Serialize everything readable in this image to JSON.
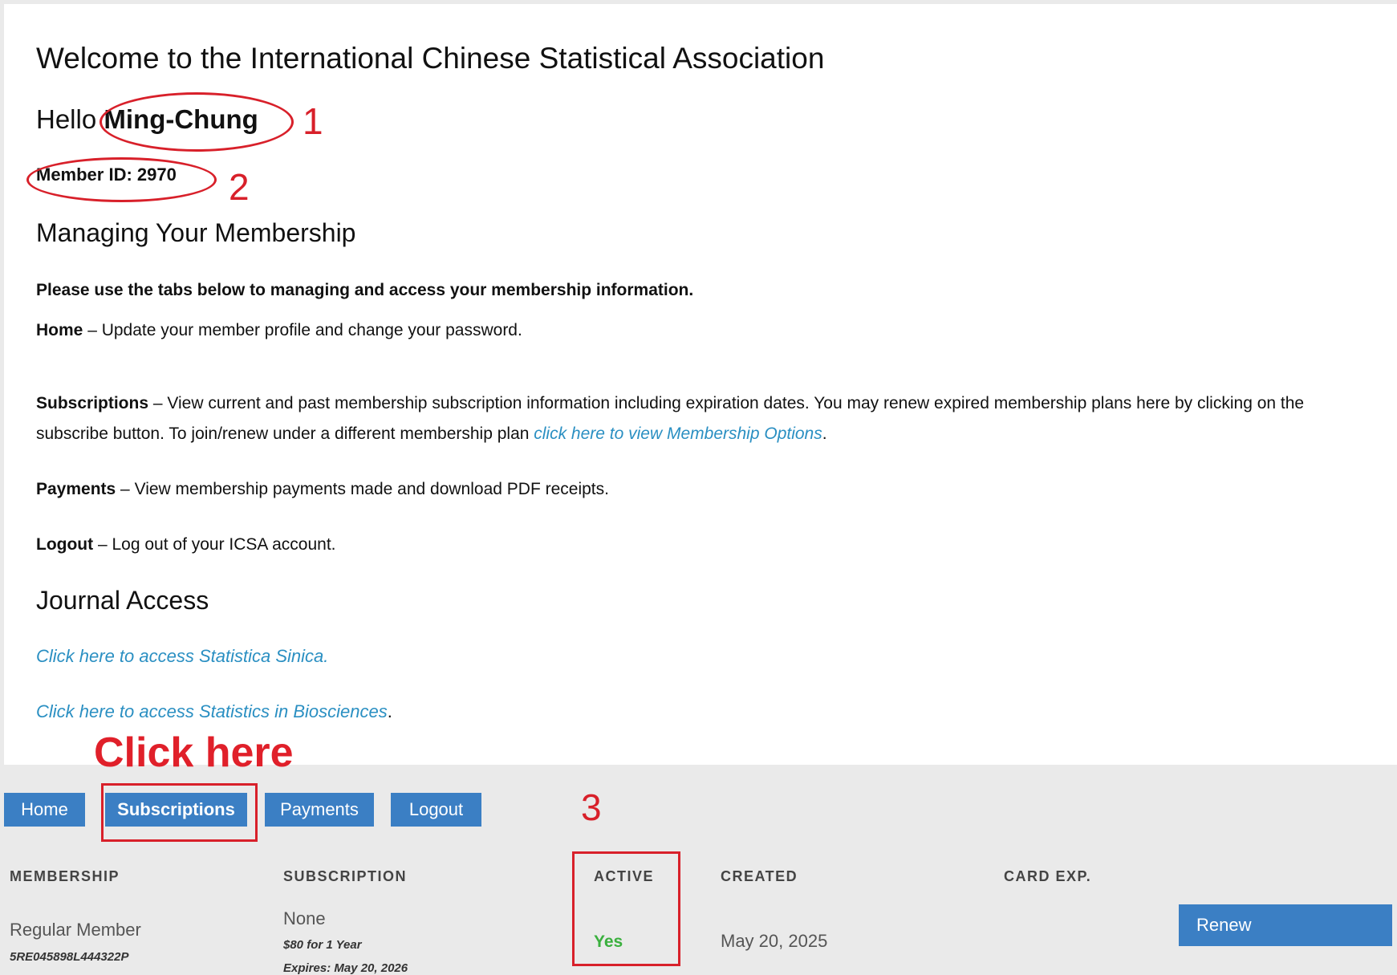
{
  "main": {
    "welcome_title": "Welcome to the International Chinese Statistical Association",
    "hello_prefix": "Hello",
    "user_name": "Ming-Chung",
    "member_id_label": "Member ID: 2970",
    "managing_heading": "Managing Your Membership",
    "intro_text": "Please use the tabs below to managing and access your membership information.",
    "descriptions": {
      "home_term": "Home",
      "home_text": " – Update your member profile and change your password.",
      "subscriptions_term": "Subscriptions",
      "subscriptions_text": " – View current and past membership subscription information including expiration dates. You may renew expired membership plans here by clicking on the subscribe button. To join/renew under a different membership plan ",
      "subscriptions_link": "click here to view Membership Options",
      "subscriptions_end": ".",
      "payments_term": "Payments",
      "payments_text": " – View membership payments made and download PDF receipts.",
      "logout_term": "Logout",
      "logout_text": " – Log out of your ICSA account."
    },
    "journal_heading": "Journal Access",
    "journal_link_1": "Click here to access Statistica Sinica.",
    "journal_link_2": "Click here to access Statistics in Biosciences",
    "journal_link_2_end": "."
  },
  "annotations": {
    "num_1": "1",
    "num_2": "2",
    "num_3": "3",
    "click_here": "Click here",
    "color": "#d8202a"
  },
  "tabs": [
    {
      "label": "Home"
    },
    {
      "label": "Subscriptions",
      "active": true
    },
    {
      "label": "Payments"
    },
    {
      "label": "Logout"
    }
  ],
  "table": {
    "headers": [
      "MEMBERSHIP",
      "SUBSCRIPTION",
      "ACTIVE",
      "CREATED",
      "CARD EXP."
    ],
    "row": {
      "membership": "Regular Member",
      "membership_code": "5RE045898L444322P",
      "subscription": "None",
      "subscription_price": "$80 for 1 Year",
      "subscription_expires": "Expires: May 20, 2026",
      "active": "Yes",
      "created": "May 20, 2025",
      "card_exp": "",
      "renew_label": "Renew"
    }
  },
  "colors": {
    "tab_blue": "#3b7fc4",
    "link_blue": "#2a8fc2",
    "active_green": "#3ab03e",
    "background_gray": "#eaeaea"
  }
}
